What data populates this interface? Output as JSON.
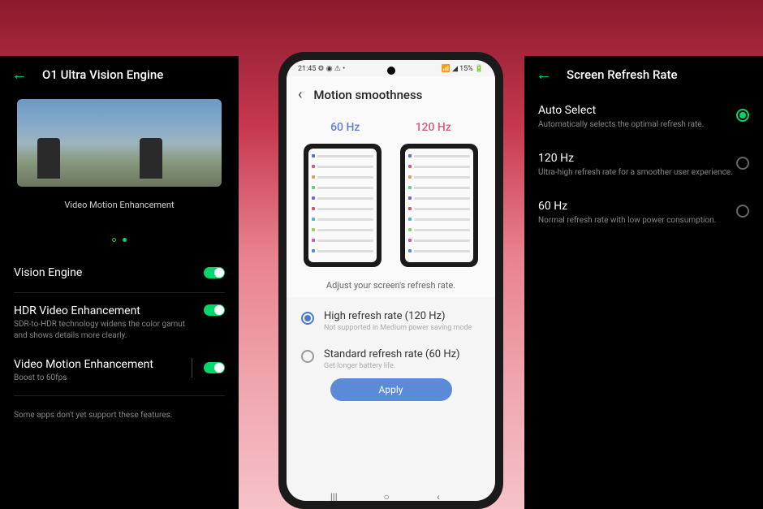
{
  "left": {
    "title": "O1 Ultra Vision Engine",
    "preview_caption": "Video Motion Enhancement",
    "vision_engine": "Vision Engine",
    "hdr_title": "HDR Video Enhancement",
    "hdr_desc": "SDR-to-HDR technology widens the color gamut and shows details more clearly.",
    "vme_title": "Video Motion Enhancement",
    "vme_desc": "Boost to 60fps",
    "footer": "Some apps don't yet support these features."
  },
  "phone": {
    "status_left": "21:45",
    "status_right": "15%",
    "title": "Motion smoothness",
    "hz60": "60 Hz",
    "hz120": "120 Hz",
    "adjust": "Adjust your screen's refresh rate.",
    "opt1_title": "High refresh rate (120 Hz)",
    "opt1_sub": "Not supported in Medium power saving mode",
    "opt2_title": "Standard refresh rate (60 Hz)",
    "opt2_sub": "Get longer battery life.",
    "apply": "Apply"
  },
  "right": {
    "title": "Screen Refresh Rate",
    "opt1_title": "Auto Select",
    "opt1_desc": "Automatically selects the optimal refresh rate.",
    "opt2_title": "120 Hz",
    "opt2_desc": "Ultra-high refresh rate for a smoother user experience.",
    "opt3_title": "60 Hz",
    "opt3_desc": "Normal refresh rate with low power consumption."
  }
}
